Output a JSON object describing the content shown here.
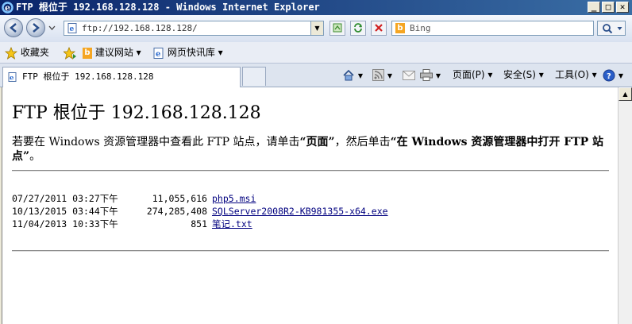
{
  "window": {
    "title": "FTP 根位于 192.168.128.128 - Windows Internet Explorer",
    "minimize": "_",
    "maximize": "□",
    "close": "✕"
  },
  "address_bar": {
    "url": "ftp://192.168.128.128/",
    "dropdown": "▼"
  },
  "search": {
    "placeholder": "Bing"
  },
  "favorites_bar": {
    "favorites_label": "收藏夹",
    "items": [
      {
        "label": "建议网站 ▾"
      },
      {
        "label": "网页快讯库 ▾"
      }
    ]
  },
  "tabs": [
    {
      "label": "FTP 根位于 192.168.128.128"
    }
  ],
  "command_bar": {
    "page": "页面(P) ▾",
    "safety": "安全(S) ▾",
    "tools": "工具(O) ▾"
  },
  "page": {
    "heading": "FTP 根位于 192.168.128.128",
    "instruction_prefix": "若要在 Windows 资源管理器中查看此 FTP 站点，请单击",
    "instruction_bold1": "“页面”",
    "instruction_mid": "，然后单击",
    "instruction_bold2": "“在 Windows 资源管理器中打开 FTP 站点”",
    "instruction_suffix": "。",
    "files": [
      {
        "date": "07/27/2011 03:27下午",
        "size": "11,055,616",
        "name": "php5.msi"
      },
      {
        "date": "10/13/2015 03:44下午",
        "size": "274,285,408",
        "name": "SQLServer2008R2-KB981355-x64.exe"
      },
      {
        "date": "11/04/2013 10:33下午",
        "size": "851",
        "name": "笔记.txt"
      }
    ]
  },
  "colors": {
    "link": "#00007f",
    "titlebar": "#0a246a"
  }
}
